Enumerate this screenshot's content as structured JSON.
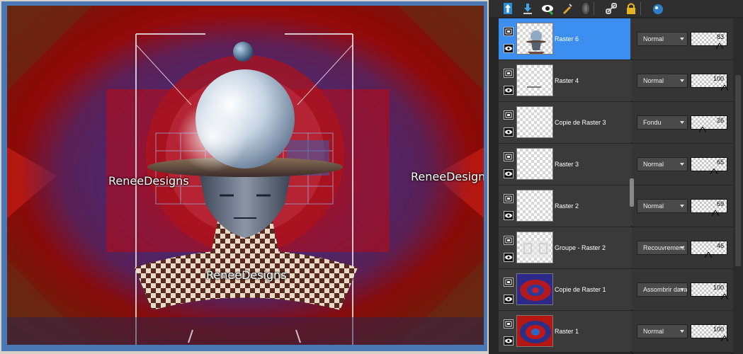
{
  "canvas": {
    "watermarks": [
      "ReneeDesigns",
      "ReneeDesigns",
      "ReneeDesigns"
    ]
  },
  "toolbar": {
    "icons": [
      "move-layer-up-icon",
      "merge-down-icon",
      "visibility-icon",
      "edit-layer-icon",
      "mask-icon",
      "link-icon",
      "lock-icon",
      "palette-icon"
    ]
  },
  "layers": [
    {
      "name": "Raster 6",
      "blend": "Normal",
      "opacity": 83,
      "selected": true,
      "thumb": "figure"
    },
    {
      "name": "Raster 4",
      "blend": "Normal",
      "opacity": 100,
      "selected": false,
      "thumb": "text"
    },
    {
      "name": "Copie de Raster 3",
      "blend": "Fondu",
      "opacity": 26,
      "selected": false,
      "thumb": "empty"
    },
    {
      "name": "Raster 3",
      "blend": "Normal",
      "opacity": 65,
      "selected": false,
      "thumb": "empty"
    },
    {
      "name": "Raster 2",
      "blend": "Normal",
      "opacity": 69,
      "selected": false,
      "thumb": "empty"
    },
    {
      "name": "Groupe - Raster 2",
      "blend": "Recouvrement",
      "opacity": 46,
      "selected": false,
      "thumb": "faint"
    },
    {
      "name": "Copie de Raster 1",
      "blend": "Assombrir davantage",
      "opacity": 100,
      "selected": false,
      "thumb": "blue-red"
    },
    {
      "name": "Raster 1",
      "blend": "Normal",
      "opacity": 100,
      "selected": false,
      "thumb": "red-blue"
    }
  ],
  "colors": {
    "selection": "#3c8ff0",
    "panel_bg": "#262626",
    "canvas_red": "#b3090d",
    "canvas_blue": "#2a2d7a"
  }
}
